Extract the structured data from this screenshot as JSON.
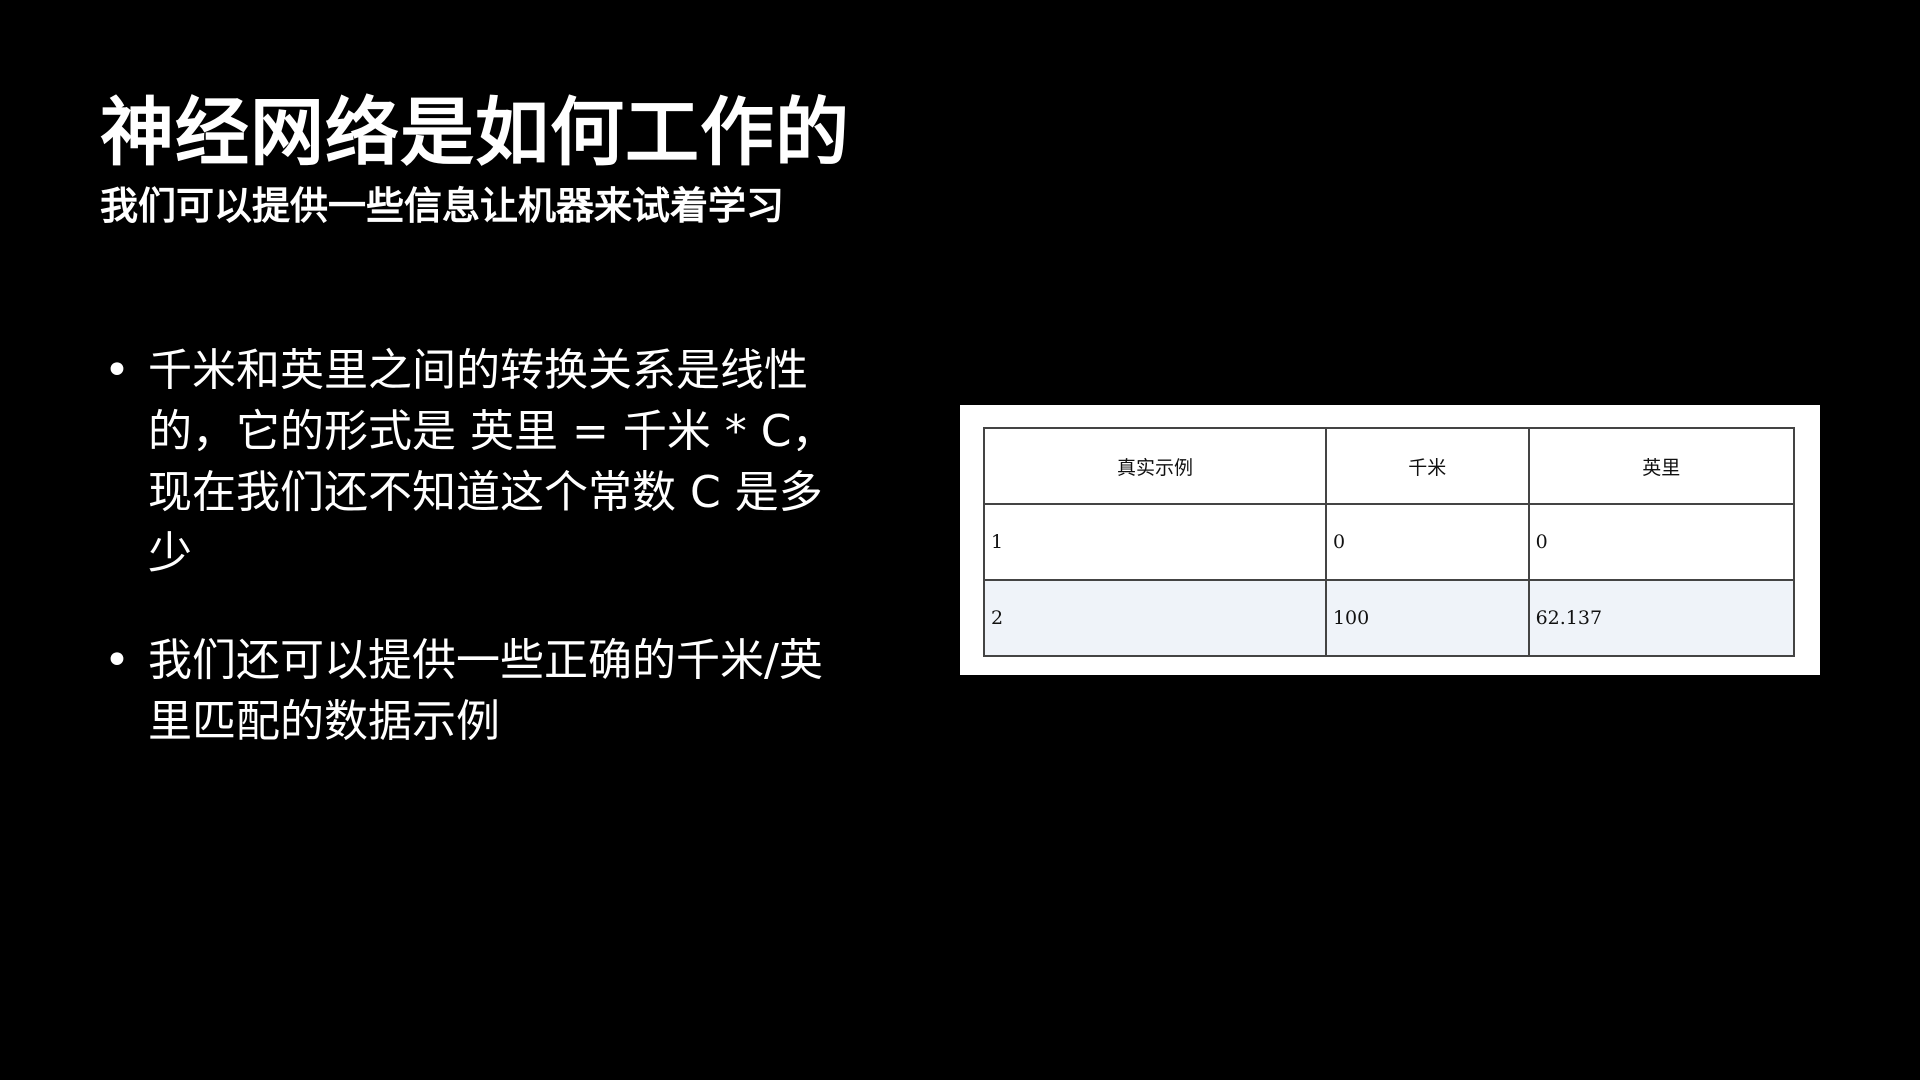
{
  "slide": {
    "title": "神经网络是如何工作的",
    "subtitle": "我们可以提供一些信息让机器来试着学习",
    "bullets": [
      "千米和英里之间的转换关系是线性的，它的形式是 英里 = 千米 * C，现在我们还不知道这个常数 C 是多少",
      "我们还可以提供一些正确的千米/英里匹配的数据示例"
    ],
    "bullet_marker": "•"
  },
  "table": {
    "headers": [
      "真实示例",
      "千米",
      "英里"
    ],
    "rows": [
      [
        "1",
        "0",
        "0"
      ],
      [
        "2",
        "100",
        "62.137"
      ]
    ],
    "colors": {
      "alt_row": "#eff3f9",
      "border": "#444444",
      "card": "#ffffff"
    }
  },
  "colors": {
    "background": "#000000",
    "text": "#ffffff"
  }
}
